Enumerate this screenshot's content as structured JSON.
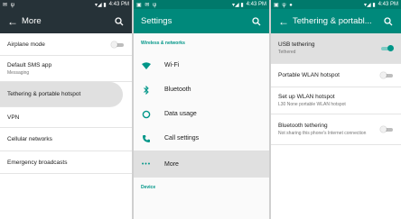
{
  "status": {
    "time": "4:43 PM"
  },
  "screen1": {
    "title": "More",
    "items": [
      {
        "label": "Airplane mode",
        "sub": ""
      },
      {
        "label": "Default SMS app",
        "sub": "Messaging"
      },
      {
        "label": "Tethering & portable hotspot",
        "sub": ""
      },
      {
        "label": "VPN",
        "sub": ""
      },
      {
        "label": "Cellular networks",
        "sub": ""
      },
      {
        "label": "Emergency broadcasts",
        "sub": ""
      }
    ]
  },
  "screen2": {
    "title": "Settings",
    "section_wireless": "Wireless & networks",
    "items": [
      {
        "label": "Wi-Fi",
        "icon": "wifi-icon"
      },
      {
        "label": "Bluetooth",
        "icon": "bluetooth-icon"
      },
      {
        "label": "Data usage",
        "icon": "data-usage-icon"
      },
      {
        "label": "Call settings",
        "icon": "phone-icon"
      },
      {
        "label": "More",
        "icon": "more-icon"
      }
    ],
    "section_device": "Device"
  },
  "screen3": {
    "title": "Tethering & portabl...",
    "items": [
      {
        "label": "USB tethering",
        "sub": "Tethered",
        "switch_on": true
      },
      {
        "label": "Portable WLAN hotspot",
        "sub": "",
        "switch_on": false
      },
      {
        "label": "Set up WLAN hotspot",
        "sub": "L30 None portable WLAN hotspot"
      },
      {
        "label": "Bluetooth tethering",
        "sub": "Not sharing this phone's Internet connection",
        "switch_on": false
      }
    ]
  },
  "colors": {
    "dark_bar": "#263238",
    "teal_bar": "#00897b",
    "accent": "#009688",
    "highlight": "#e0e0e0"
  }
}
